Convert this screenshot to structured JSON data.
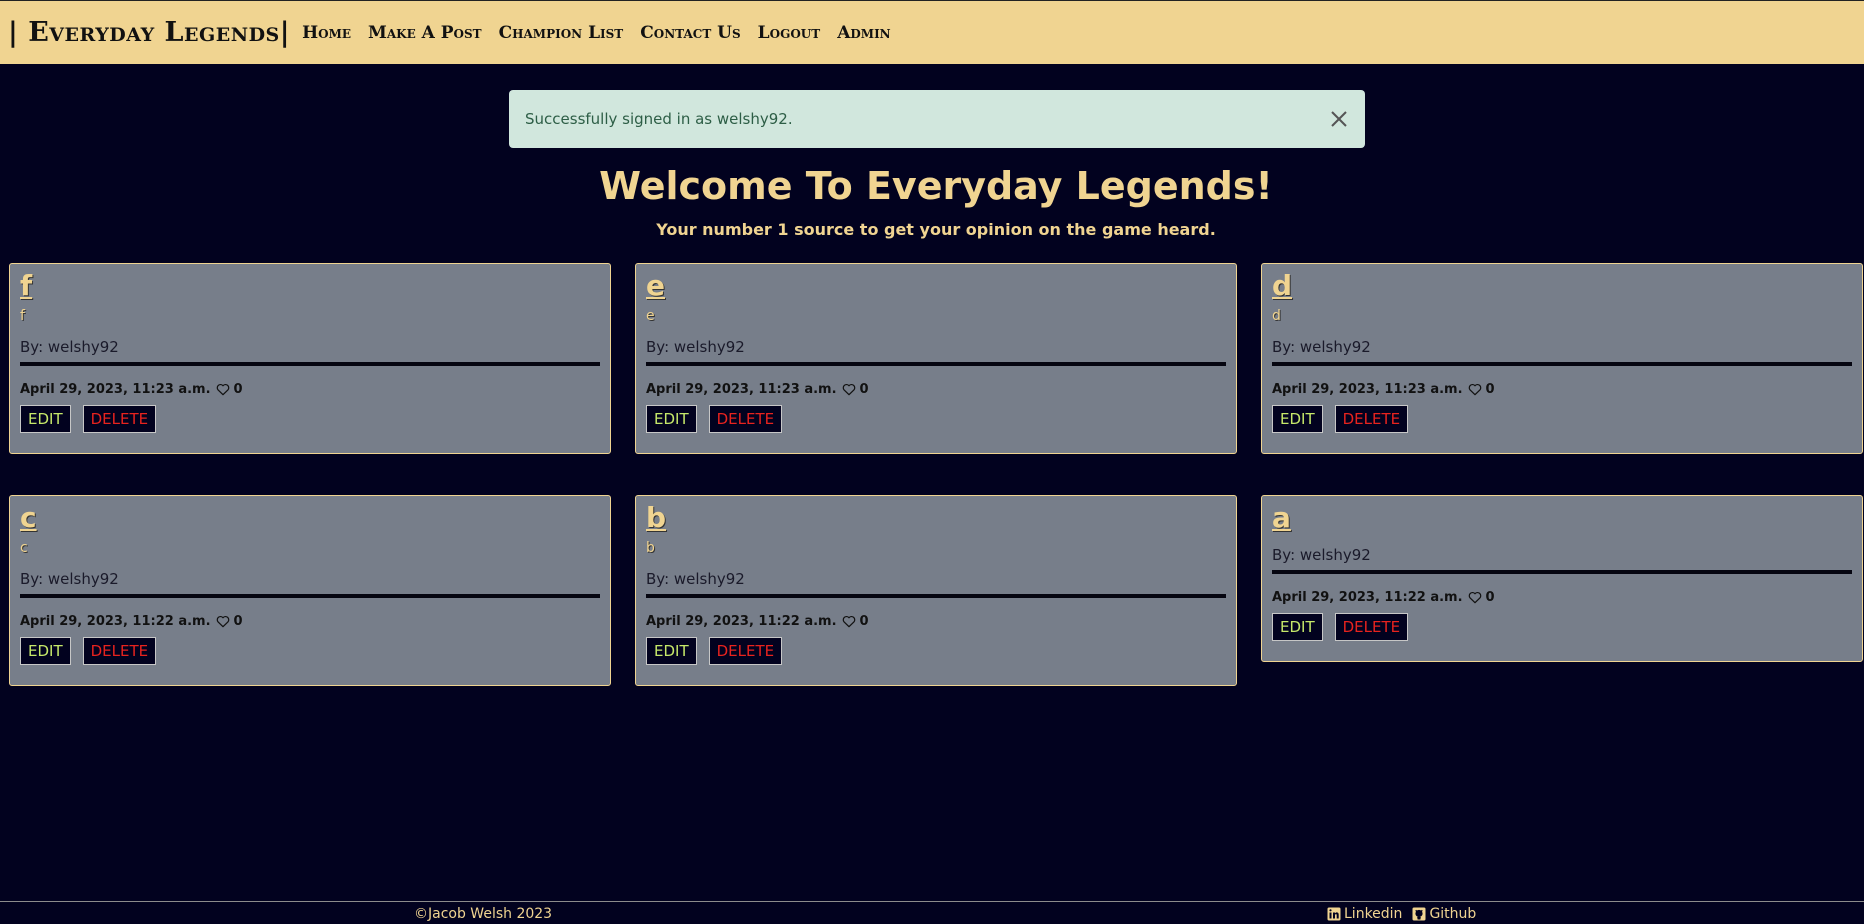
{
  "navbar": {
    "brand": "| Everyday Legends|",
    "links": [
      "Home",
      "Make A Post",
      "Champion List",
      "Contact Us",
      "Logout",
      "Admin"
    ]
  },
  "alert": {
    "message": "Successfully signed in as welshy92."
  },
  "hero": {
    "title": "Welcome To Everyday Legends!",
    "subtitle": "Your number 1 source to get your opinion on the game heard."
  },
  "posts": [
    {
      "title": "f",
      "excerpt": "f",
      "author": "By: welshy92",
      "date": "April 29, 2023, 11:23 a.m.",
      "likes": "0",
      "edit_label": "EDIT",
      "delete_label": "DELETE"
    },
    {
      "title": "e",
      "excerpt": "e",
      "author": "By: welshy92",
      "date": "April 29, 2023, 11:23 a.m.",
      "likes": "0",
      "edit_label": "EDIT",
      "delete_label": "DELETE"
    },
    {
      "title": "d",
      "excerpt": "d",
      "author": "By: welshy92",
      "date": "April 29, 2023, 11:23 a.m.",
      "likes": "0",
      "edit_label": "EDIT",
      "delete_label": "DELETE"
    },
    {
      "title": "c",
      "excerpt": "c",
      "author": "By: welshy92",
      "date": "April 29, 2023, 11:22 a.m.",
      "likes": "0",
      "edit_label": "EDIT",
      "delete_label": "DELETE"
    },
    {
      "title": "b",
      "excerpt": "b",
      "author": "By: welshy92",
      "date": "April 29, 2023, 11:22 a.m.",
      "likes": "0",
      "edit_label": "EDIT",
      "delete_label": "DELETE"
    },
    {
      "title": "a",
      "excerpt": "",
      "author": "By: welshy92",
      "date": "April 29, 2023, 11:22 a.m.",
      "likes": "0",
      "edit_label": "EDIT",
      "delete_label": "DELETE"
    }
  ],
  "footer": {
    "copyright": "©Jacob Welsh 2023",
    "linkedin": "Linkedin",
    "github": "Github"
  },
  "colors": {
    "background": "#02021f",
    "accent": "#f0d491",
    "card": "#777e8a",
    "alert": "#d1e7dd",
    "edit": "#c6e86a",
    "delete": "#e8231e"
  }
}
